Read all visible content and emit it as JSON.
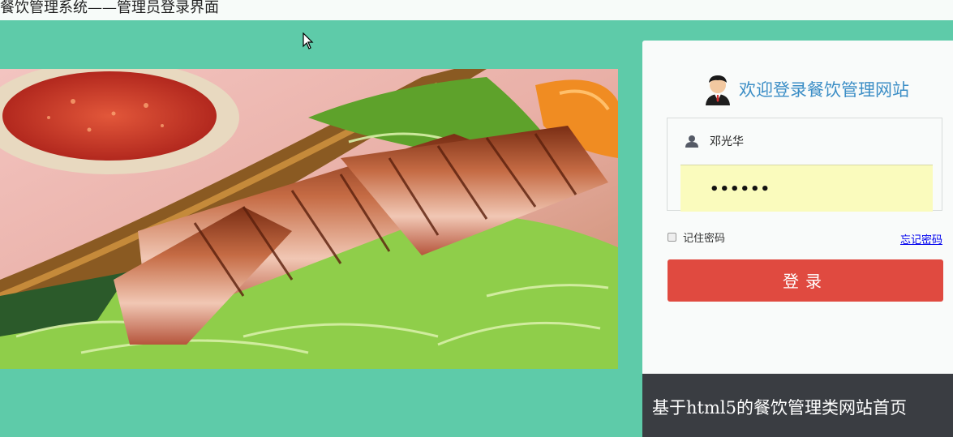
{
  "window": {
    "title": "餐饮管理系统——管理员登录界面"
  },
  "login": {
    "heading": "欢迎登录餐饮管理网站",
    "username_value": "邓光华",
    "password_value": "••••••",
    "remember_label": "记住密码",
    "forgot_link": "忘记密码",
    "submit_label": "登录"
  },
  "footer": {
    "text": "基于html5的餐饮管理类网站首页"
  },
  "icons": {
    "avatar": "user-avatar-icon",
    "user": "user-icon",
    "cursor": "mouse-cursor-icon"
  },
  "colors": {
    "background": "#5ecba9",
    "button": "#e04a40",
    "heading": "#3c8ec6",
    "password_field": "#fafbbd",
    "footer": "#3a3d42"
  }
}
